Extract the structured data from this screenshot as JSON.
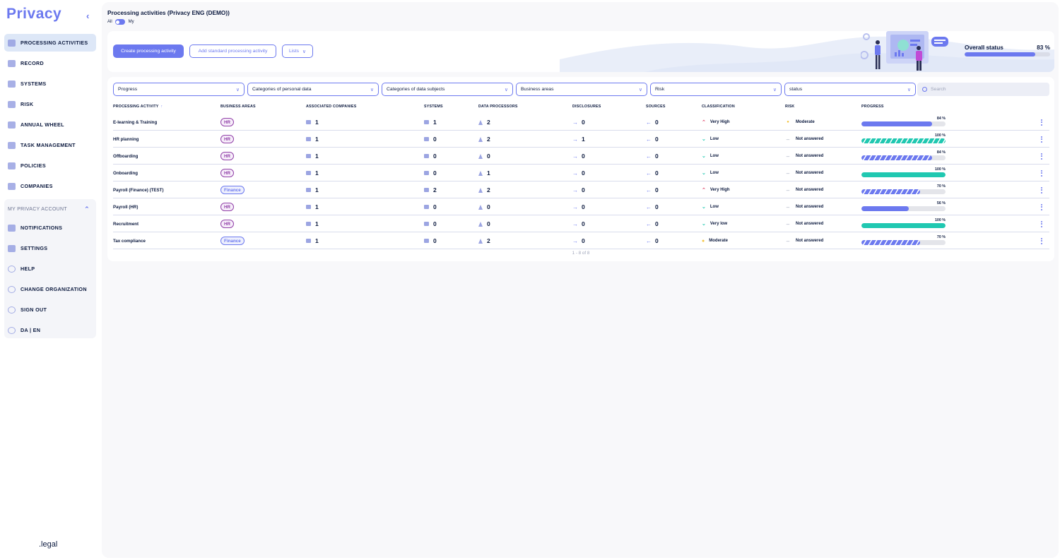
{
  "brand": "Privacy",
  "footer_logo": ".legal",
  "nav": [
    {
      "label": "PROCESSING ACTIVITIES",
      "icon": "processing-icon",
      "active": true
    },
    {
      "label": "RECORD",
      "icon": "record-icon"
    },
    {
      "label": "SYSTEMS",
      "icon": "systems-icon"
    },
    {
      "label": "RISK",
      "icon": "risk-icon"
    },
    {
      "label": "ANNUAL WHEEL",
      "icon": "annual-wheel-icon"
    },
    {
      "label": "TASK MANAGEMENT",
      "icon": "task-icon"
    },
    {
      "label": "POLICIES",
      "icon": "policies-icon"
    },
    {
      "label": "COMPANIES",
      "icon": "companies-icon"
    }
  ],
  "account": {
    "title": "MY PRIVACY ACCOUNT",
    "items": [
      {
        "label": "NOTIFICATIONS",
        "icon": "bell-icon"
      },
      {
        "label": "SETTINGS",
        "icon": "gear-icon"
      },
      {
        "label": "HELP",
        "icon": "help-icon"
      },
      {
        "label": "CHANGE ORGANIZATION",
        "icon": "swap-icon"
      },
      {
        "label": "SIGN OUT",
        "icon": "sign-out-icon"
      },
      {
        "label": "DA  |  EN",
        "icon": "globe-icon"
      }
    ]
  },
  "page": {
    "title": "Processing activities (Privacy ENG (DEMO))",
    "toggle_all": "All",
    "toggle_my": "My"
  },
  "toolbar": {
    "create_label": "Create processing activity",
    "standard_label": "Add standard processing activity",
    "lists_label": "Lists"
  },
  "overall": {
    "label": "Overall status",
    "value_text": "83 %",
    "value": 0.83
  },
  "filters": [
    "Progress",
    "Categories of personal data",
    "Categories of data subjects",
    "Business areas",
    "Risk",
    "status"
  ],
  "search": {
    "placeholder": "Search"
  },
  "columns": [
    "PROCESSING ACTIVITY",
    "BUSINESS AREAS",
    "ASSOCIATED COMPANIES",
    "SYSTEMS",
    "DATA PROCESSORS",
    "DISCLOSURES",
    "SOURCES",
    "CLASSIFICATION",
    "RISK",
    "PROGRESS"
  ],
  "rows": [
    {
      "name": "E-learning & Training",
      "area": "HR",
      "companies": "1",
      "systems": "1",
      "processors": "2",
      "disclosures": "0",
      "sources": "0",
      "classification": "Very High",
      "risk": "Moderate",
      "progress": 84,
      "progress_text": "84 %",
      "bar": "blue"
    },
    {
      "name": "HR planning",
      "area": "HR",
      "companies": "1",
      "systems": "0",
      "processors": "2",
      "disclosures": "1",
      "sources": "0",
      "classification": "Low",
      "risk": "Not answered",
      "progress": 100,
      "progress_text": "100 %",
      "bar": "teal-pattern"
    },
    {
      "name": "Offboarding",
      "area": "HR",
      "companies": "1",
      "systems": "0",
      "processors": "0",
      "disclosures": "0",
      "sources": "0",
      "classification": "Low",
      "risk": "Not answered",
      "progress": 84,
      "progress_text": "84 %",
      "bar": "blue-pattern"
    },
    {
      "name": "Onboarding",
      "area": "HR",
      "companies": "1",
      "systems": "0",
      "processors": "1",
      "disclosures": "0",
      "sources": "0",
      "classification": "Low",
      "risk": "Not answered",
      "progress": 100,
      "progress_text": "100 %",
      "bar": "teal"
    },
    {
      "name": "Payroll (Finance) (TEST)",
      "area": "Finance",
      "companies": "1",
      "systems": "2",
      "processors": "2",
      "disclosures": "0",
      "sources": "0",
      "classification": "Very High",
      "risk": "Not answered",
      "progress": 70,
      "progress_text": "70 %",
      "bar": "blue-pattern"
    },
    {
      "name": "Payroll (HR)",
      "area": "HR",
      "companies": "1",
      "systems": "0",
      "processors": "0",
      "disclosures": "0",
      "sources": "0",
      "classification": "Low",
      "risk": "Not answered",
      "progress": 56,
      "progress_text": "56 %",
      "bar": "blue"
    },
    {
      "name": "Recruitment",
      "area": "HR",
      "companies": "1",
      "systems": "0",
      "processors": "0",
      "disclosures": "0",
      "sources": "0",
      "classification": "Very low",
      "risk": "Not answered",
      "progress": 100,
      "progress_text": "100 %",
      "bar": "teal"
    },
    {
      "name": "Tax compliance",
      "area": "Finance",
      "companies": "1",
      "systems": "0",
      "processors": "2",
      "disclosures": "0",
      "sources": "0",
      "classification": "Moderate",
      "risk": "Not answered",
      "progress": 70,
      "progress_text": "70 %",
      "bar": "blue-pattern"
    }
  ],
  "pagination": "1 - 8 of 8",
  "colors": {
    "accent": "#6c79ef",
    "teal": "#20c8b1",
    "hr": "#9140a8",
    "high": "#e0476b",
    "low": "#20c8b1",
    "moderate": "#f4c542"
  }
}
